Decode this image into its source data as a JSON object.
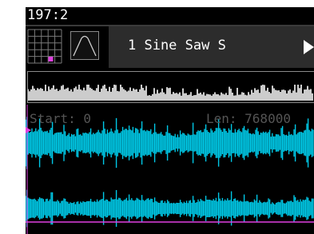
{
  "header": {
    "position": "197:2"
  },
  "toolbar": {
    "grid_icon": "grid-icon",
    "envelope_icon": "envelope-icon",
    "patch_name": "1 Sine Saw S",
    "play_icon": "play-icon"
  },
  "waveform": {
    "start_label": "Start: 0",
    "length_label": "Len: 768000"
  },
  "colors": {
    "background": "#000000",
    "waveform": "#00c8e6",
    "cursor": "#e040e0",
    "accent_pad": "#e040e0",
    "grid_lines": "#7a7a7a",
    "tab": "#2c2c2c",
    "text": "#ffffff"
  }
}
